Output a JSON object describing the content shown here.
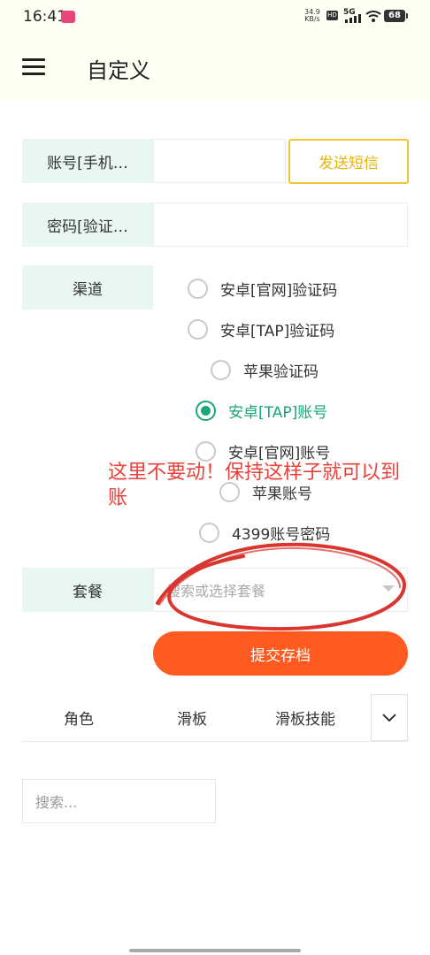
{
  "status_bar": {
    "time": "16:41",
    "net_speed_value": "34.9",
    "net_speed_unit": "KB/s",
    "hd": "HD",
    "network": "5G",
    "battery": "68"
  },
  "header": {
    "title": "自定义"
  },
  "form": {
    "account_label": "账号[手机…",
    "send_sms_label": "发送短信",
    "password_label": "密码[验证…",
    "channel_label": "渠道",
    "channels": [
      {
        "label": "安卓[官网]验证码",
        "checked": false
      },
      {
        "label": "安卓[TAP]验证码",
        "checked": false
      },
      {
        "label": "苹果验证码",
        "checked": false
      },
      {
        "label": "安卓[TAP]账号",
        "checked": true
      },
      {
        "label": "安卓[官网]账号",
        "checked": false
      },
      {
        "label": "苹果账号",
        "checked": false
      },
      {
        "label": "4399账号密码",
        "checked": false
      }
    ],
    "package_label": "套餐",
    "package_placeholder": "搜索或选择套餐",
    "submit_label": "提交存档"
  },
  "tabs": [
    "角色",
    "滑板",
    "滑板技能"
  ],
  "search": {
    "placeholder": "搜索..."
  },
  "annotation": {
    "text": "这里不要动！保持这样子就可以到账",
    "color": "#e8413a"
  },
  "colors": {
    "accent_green": "#1aa57a",
    "submit_orange": "#ff5a1f",
    "sms_border": "#f1c232",
    "label_bg": "#e8f6f4"
  },
  "icons": [
    "menu-icon",
    "chevron-down-icon",
    "wifi-icon",
    "signal-icon"
  ]
}
